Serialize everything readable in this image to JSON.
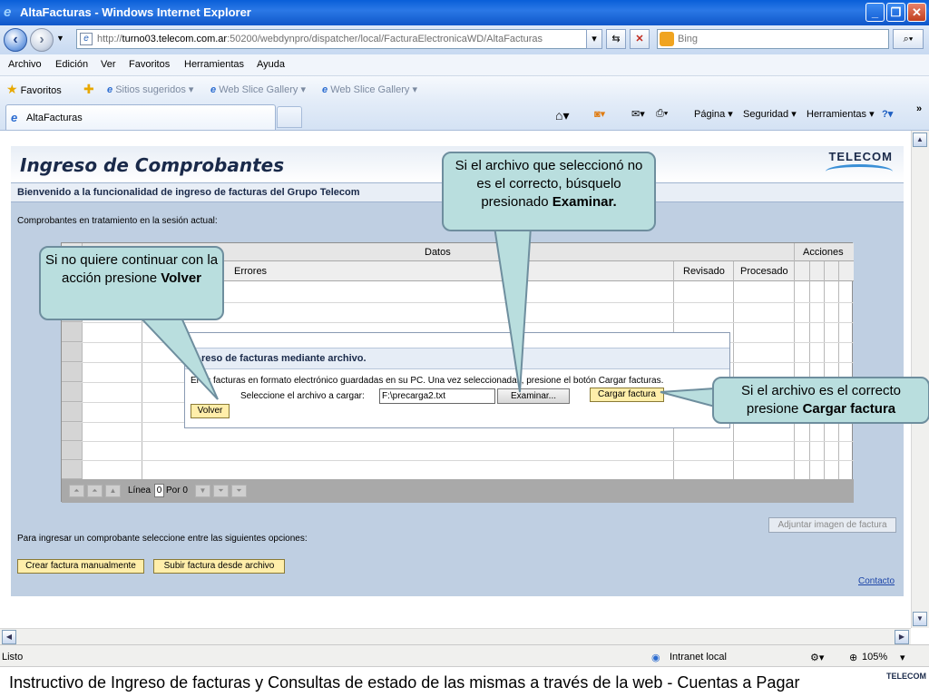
{
  "window": {
    "title": "AltaFacturas - Windows Internet Explorer",
    "buttons": [
      "_",
      "❐",
      "✕"
    ]
  },
  "address": {
    "url_prefix": "http://",
    "url_host": "turno03.telecom.com.ar",
    "url_rest": ":50200/webdynpro/dispatcher/local/FacturaElectronicaWD/AltaFacturas",
    "search_placeholder": "Bing"
  },
  "menu": [
    "Archivo",
    "Edición",
    "Ver",
    "Favoritos",
    "Herramientas",
    "Ayuda"
  ],
  "favorites": {
    "label": "Favoritos",
    "items": [
      "Sitios sugeridos ▾",
      "Web Slice Gallery ▾",
      "Web Slice Gallery ▾"
    ]
  },
  "tab": {
    "label": "AltaFacturas"
  },
  "commands": [
    "Página ▾",
    "Seguridad ▾",
    "Herramientas ▾"
  ],
  "page": {
    "title": "Ingreso de Comprobantes",
    "logo": "TELECOM",
    "welcome": "Bienvenido a la funcionalidad de ingreso de facturas del Grupo Telecom",
    "session_label": "Comprobantes en tratamiento en la sesión actual:",
    "grid": {
      "header_datos": "Datos",
      "header_acciones": "Acciones",
      "col_errores": "Errores",
      "col_revisado": "Revisado",
      "col_procesado": "Procesado",
      "footer_linea": "Línea",
      "footer_linea_value": "0",
      "footer_por": "Por 0"
    },
    "dialog": {
      "title": "reso de facturas mediante archivo.",
      "text": "El    as facturas en formato electrónico guardadas en su PC. Una vez seleccionadas, presione el botón Cargar facturas.",
      "file_label": "Seleccione el archivo a cargar:",
      "file_value": "F:\\precarga2.txt",
      "browse_label": "Examinar...",
      "upload_label": "Cargar factura",
      "back_label": "Volver"
    },
    "options_label": "Para ingresar un comprobante seleccione entre las siguientes opciones:",
    "btn_manual": "Crear factura manualmente",
    "btn_file": "Subir factura desde archivo",
    "btn_attach": "Adjuntar imagen de factura",
    "contact": "Contacto"
  },
  "status": {
    "left": "Listo",
    "zone": "Intranet local",
    "zoom": "105%"
  },
  "callouts": {
    "browse": {
      "line1": "Si el archivo que seleccionó no es el correcto, búsquelo presionado",
      "bold": "Examinar."
    },
    "back": {
      "line1": "Si no quiere continuar con la acción presione",
      "bold": "Volver"
    },
    "upload": {
      "line1": "Si el archivo es el correcto presione",
      "bold": "Cargar  factura"
    }
  },
  "footer": {
    "text": "Instructivo de Ingreso de facturas y Consultas de estado de las mismas a través de la web    -    Cuentas a Pagar",
    "logo": "TELECOM"
  },
  "colors": {
    "page_bg": "#bfcfe2",
    "callout_bg": "#b9dede",
    "button_yellow": "#ffeeaa"
  }
}
